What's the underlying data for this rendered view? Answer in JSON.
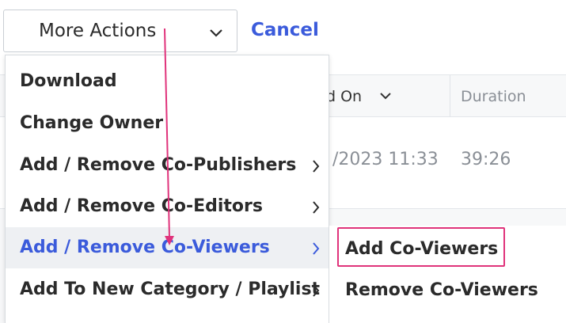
{
  "toolbar": {
    "more_actions_label": "More Actions",
    "cancel_label": "Cancel"
  },
  "table": {
    "headers": [
      {
        "label": "d On"
      },
      {
        "label": "Duration"
      }
    ],
    "rows": [
      {
        "date": "/2023 11:33",
        "duration": "39:26"
      }
    ]
  },
  "menu": {
    "items": [
      {
        "label": "Download",
        "has_submenu": false
      },
      {
        "label": "Change Owner",
        "has_submenu": false
      },
      {
        "label": "Add / Remove Co-Publishers",
        "has_submenu": true
      },
      {
        "label": "Add / Remove Co-Editors",
        "has_submenu": true
      },
      {
        "label": "Add / Remove Co-Viewers",
        "has_submenu": true,
        "active": true
      },
      {
        "label": "Add To New Category / Playlist",
        "has_submenu": true
      }
    ]
  },
  "submenu": {
    "items": [
      {
        "label": "Add Co-Viewers",
        "highlighted": true
      },
      {
        "label": "Remove Co-Viewers"
      }
    ]
  },
  "colors": {
    "accent": "#3b5bdb",
    "annotation": "#e0337b",
    "active_bg": "#eef0f3"
  }
}
